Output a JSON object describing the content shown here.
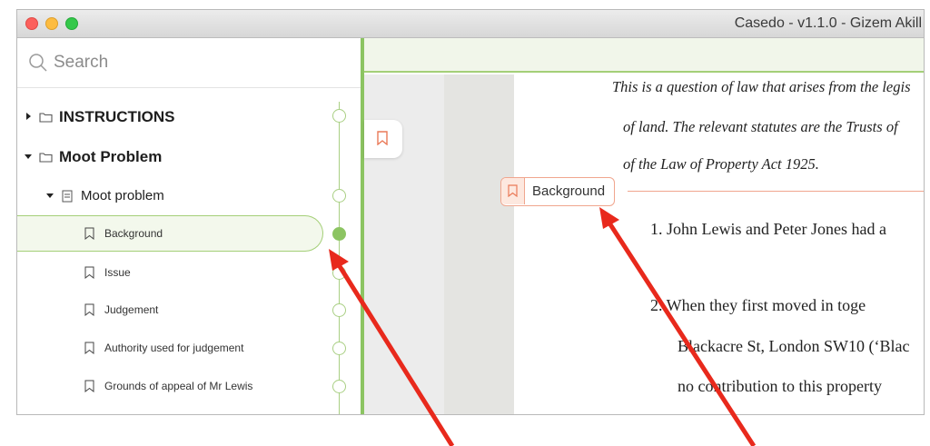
{
  "window": {
    "title": "Casedo - v1.1.0 - Gizem Akill"
  },
  "search": {
    "placeholder": "Search"
  },
  "sidebar": {
    "items": [
      {
        "label": "INSTRUCTIONS"
      },
      {
        "label": "Moot Problem"
      },
      {
        "label": "Moot problem"
      },
      {
        "label": "Background"
      },
      {
        "label": "Issue"
      },
      {
        "label": "Judgement"
      },
      {
        "label": "Authority used for judgement"
      },
      {
        "label": "Grounds of appeal of Mr Lewis"
      }
    ]
  },
  "document": {
    "lines": [
      "This is a question of law that arises from the legis",
      "of land. The relevant statutes are the Trusts of",
      "of the Law of Property Act 1925.",
      "1.   John Lewis and Peter Jones had a",
      "2.   When they first moved in toge",
      "Blackacre St, London SW10 (‘Blac",
      "no contribution to this property"
    ],
    "marker_label": "Background"
  },
  "colors": {
    "accent_green": "#8cc462",
    "marker_orange": "#f0a68e",
    "arrow_red": "#e8291c"
  }
}
